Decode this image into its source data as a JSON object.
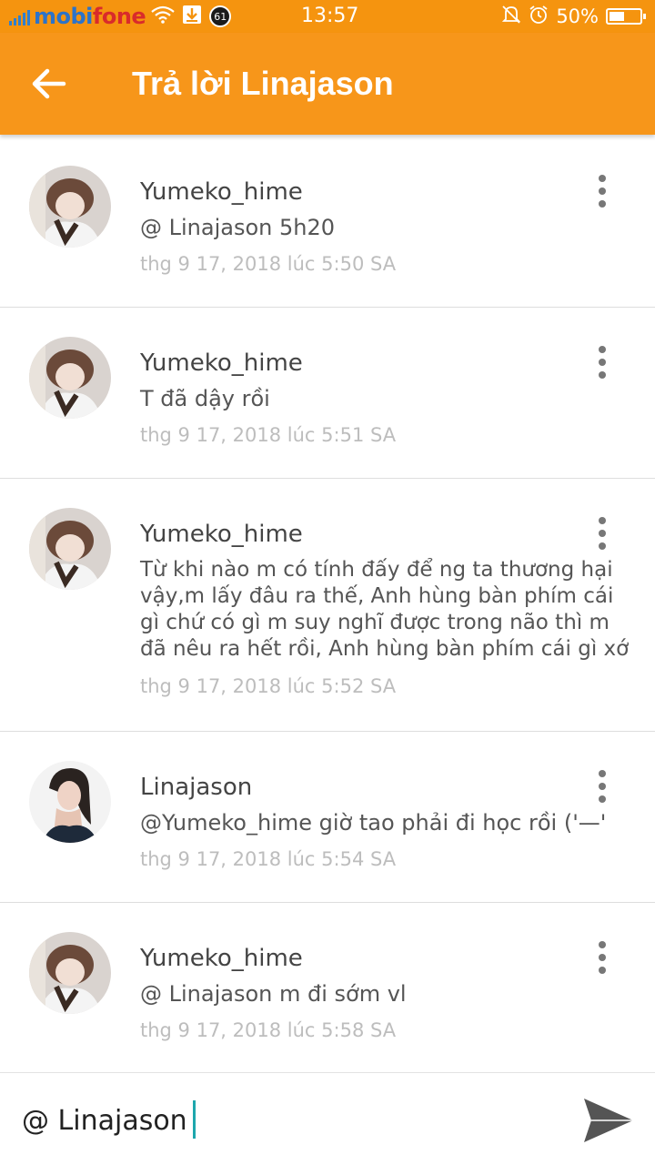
{
  "status_bar": {
    "carrier_part1": "mobi",
    "carrier_part2": "fone",
    "badge": "61",
    "time": "13:57",
    "battery": "50%",
    "battery_level": 0.5,
    "icons": [
      "signal-icon",
      "wifi-icon",
      "download-icon",
      "notification-badge-icon",
      "mute-icon",
      "alarm-icon",
      "battery-icon"
    ]
  },
  "toolbar": {
    "title": "Trả lời Linajason",
    "back_icon": "arrow-left-icon"
  },
  "comments": [
    {
      "author": "Yumeko_hime",
      "text": "@ Linajason  5h20",
      "time": "thg 9 17, 2018 lúc 5:50 SA"
    },
    {
      "author": "Yumeko_hime",
      "text": "T đã dậy rồi",
      "time": "thg 9 17, 2018 lúc 5:51 SA"
    },
    {
      "author": "Yumeko_hime",
      "text": "Từ khi nào m có tính đấy để ng ta thương hại vậy,m lấy đâu ra thế, Anh hùng bàn phím cái gì chứ có gì m suy nghĩ được trong não thì m đã nêu ra hết rồi, Anh hùng bàn phím cái gì xớ",
      "time": "thg 9 17, 2018 lúc 5:52 SA"
    },
    {
      "author": "Linajason",
      "text": "@Yumeko_hime giờ tao phải đi học rồi ('—'",
      "time": "thg 9 17, 2018 lúc 5:54 SA"
    },
    {
      "author": "Yumeko_hime",
      "text": "@ Linajason  m đi sớm vl",
      "time": "thg 9 17, 2018 lúc 5:58 SA"
    }
  ],
  "reply": {
    "value": "@ Linajason ",
    "send_icon": "send-icon"
  },
  "colors": {
    "toolbar": "#f7961a",
    "status_bar": "#f5940f",
    "caret": "#1ea7ad"
  }
}
